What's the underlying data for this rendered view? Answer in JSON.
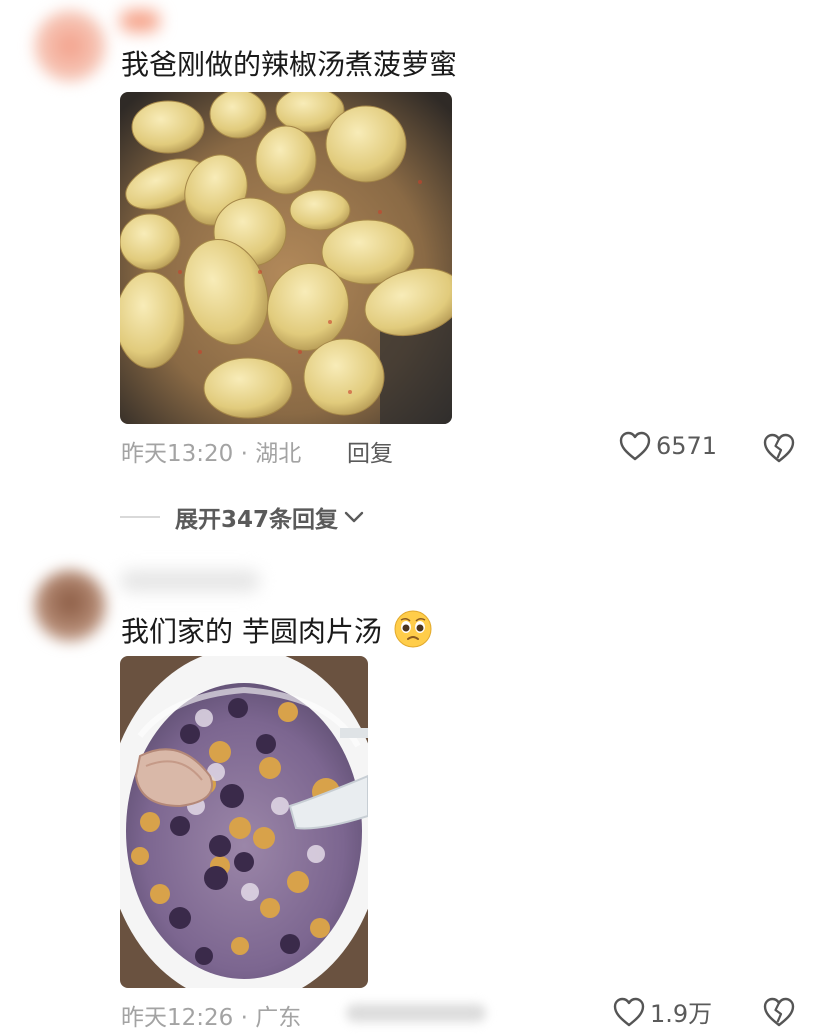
{
  "comments": [
    {
      "text": "我爸刚做的辣椒汤煮菠萝蜜",
      "time_location": "昨天13:20 · 湖北",
      "reply_label": "回复",
      "like_count": "6571",
      "image_icon": "photo-jackfruit-chili-soup"
    },
    {
      "text": "我们家的 芋圆肉片汤",
      "emoji": "crying-face-emoji",
      "time_location": "昨天12:26 · 广东",
      "like_count": "1.9万",
      "image_icon": "photo-taro-ball-pork-soup"
    }
  ],
  "expand_replies": {
    "label": "展开347条回复"
  },
  "icons": {
    "like": "heart-outline-icon",
    "dislike": "broken-heart-icon",
    "expand": "chevron-down-icon"
  },
  "colors": {
    "text": "#1a1a1a",
    "meta": "#a3a3a3",
    "action": "#5a5a5a"
  }
}
